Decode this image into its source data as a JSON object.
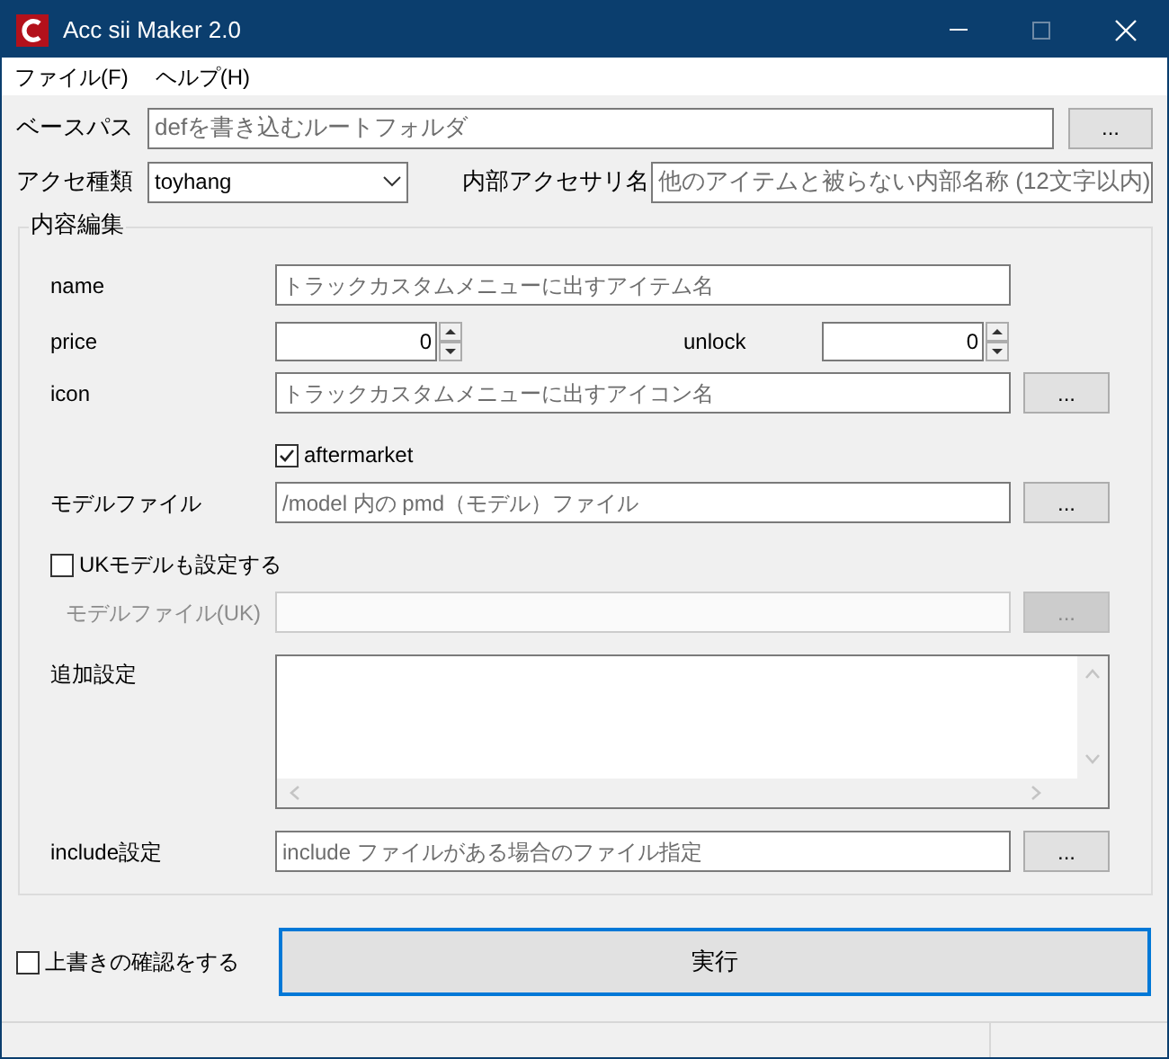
{
  "window": {
    "title": "Acc sii Maker 2.0"
  },
  "menu": [
    {
      "label": "ファイル(F)"
    },
    {
      "label": "ヘルプ(H)"
    }
  ],
  "base_path": {
    "label": "ベースパス",
    "placeholder": "defを書き込むルートフォルダ",
    "button": "..."
  },
  "accessory_type": {
    "label": "アクセ種類",
    "value": "toyhang"
  },
  "internal_name": {
    "label": "内部アクセサリ名",
    "placeholder": "他のアイテムと被らない内部名称 (12文字以内)"
  },
  "group": {
    "title": "内容編集",
    "rows": [
      {
        "kind": "text",
        "label": "name",
        "placeholder": "トラックカスタムメニューに出すアイテム名",
        "disabled": false
      },
      {
        "kind": "spin",
        "label": "price",
        "value": "0",
        "label2": "unlock",
        "value2": "0"
      },
      {
        "kind": "text",
        "label": "icon",
        "placeholder": "トラックカスタムメニューに出すアイコン名",
        "button": "...",
        "disabled": false
      },
      {
        "kind": "inline-check",
        "label": "aftermarket",
        "checked": true
      },
      {
        "kind": "text",
        "label": "モデルファイル",
        "placeholder": "/model 内の pmd（モデル）ファイル",
        "button": "...",
        "disabled": false
      },
      {
        "kind": "check",
        "label": "UKモデルも設定する",
        "checked": false
      },
      {
        "kind": "text",
        "label": "モデルファイル(UK)",
        "button": "...",
        "disabled": true
      },
      {
        "kind": "textarea",
        "label": "追加設定"
      },
      {
        "kind": "text",
        "label": "include設定",
        "placeholder": "include ファイルがある場合のファイル指定",
        "button": "...",
        "disabled": false
      }
    ]
  },
  "overwrite_confirm": {
    "label": "上書きの確認をする",
    "checked": false
  },
  "run_button": {
    "label": "実行",
    "focused": true
  }
}
